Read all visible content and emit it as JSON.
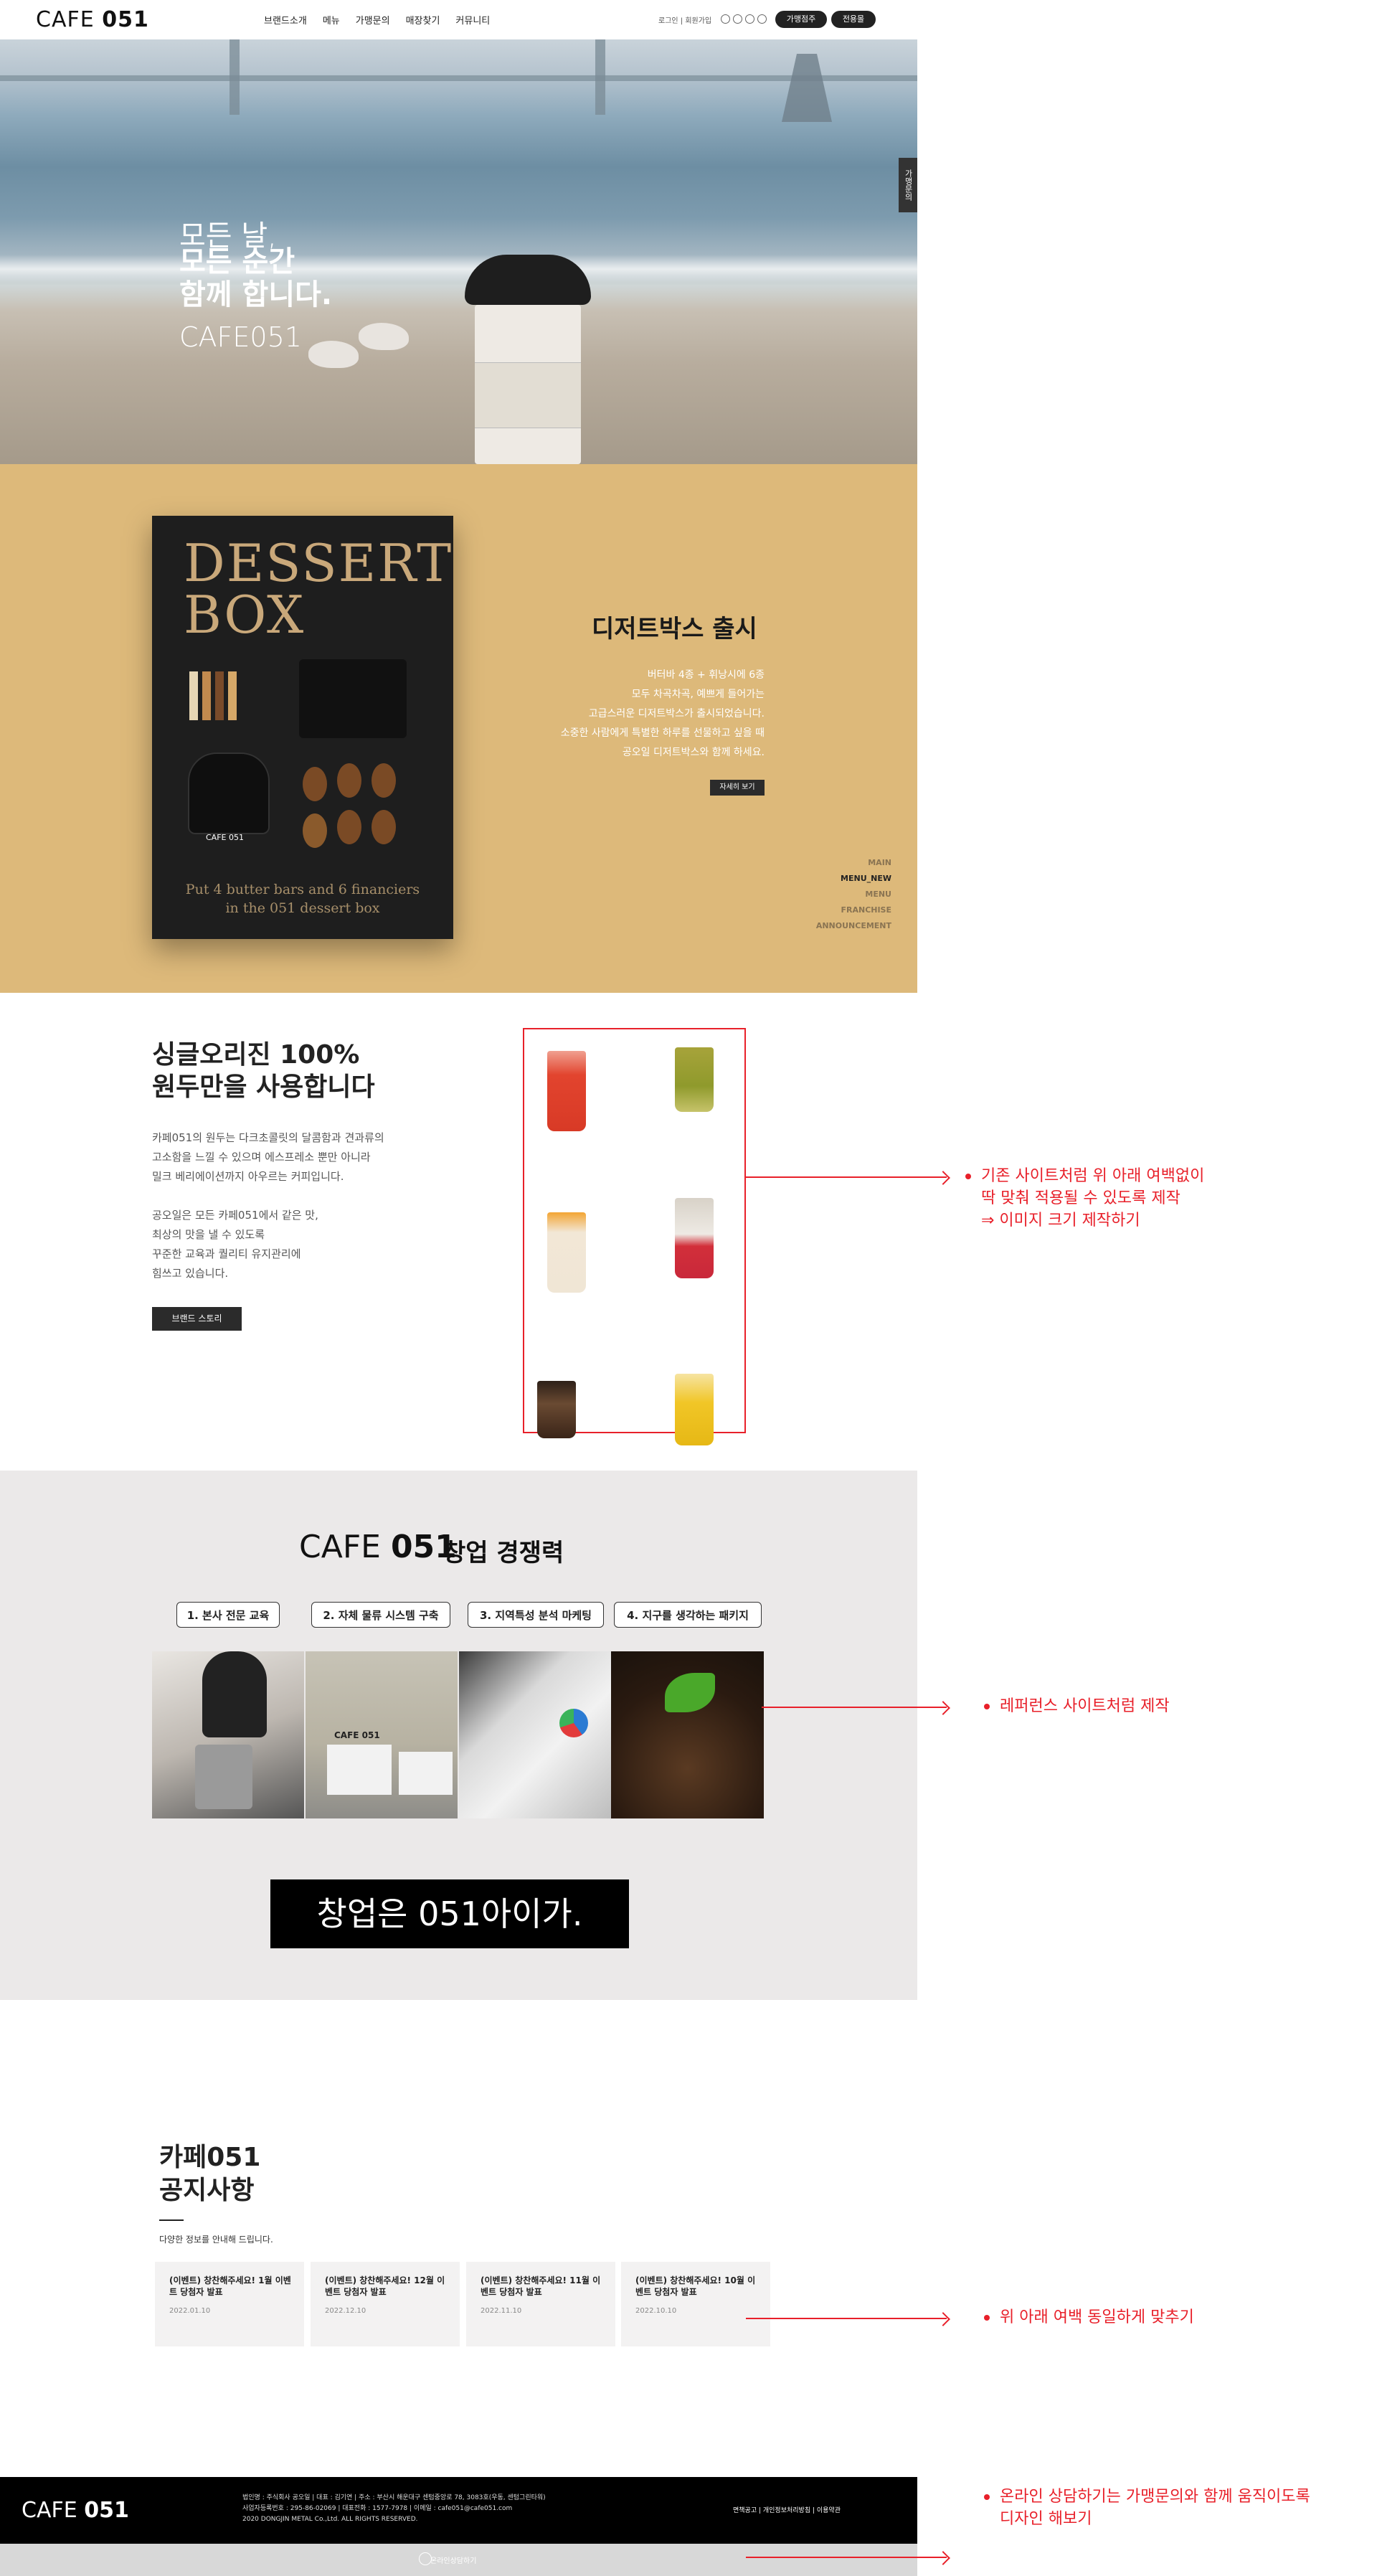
{
  "header": {
    "logo_light": "CAFE",
    "logo_bold": "051",
    "nav": [
      "브랜드소개",
      "메뉴",
      "가맹문의",
      "매장찾기",
      "커뮤니티"
    ],
    "util": "로그인 | 회원가입",
    "btn_franchise": "가맹점주",
    "btn_all": "전용몰"
  },
  "hero": {
    "line1": "모든 날,",
    "line2a": "모든 순간",
    "line2b": "함께 합니다.",
    "line3": "CAFE051",
    "side_tab": "가맹문의"
  },
  "dessert": {
    "box_title_1": "DESSERT",
    "box_title_2": "BOX",
    "box_brand": "CAFE 051",
    "box_sub_1": "Put 4 butter bars and 6 financiers",
    "box_sub_2": "in the 051 dessert box",
    "title": "디저트박스 출시",
    "desc": [
      "버터바 4종 + 휘낭시에 6종",
      "모두 차곡차곡, 예쁘게 들어가는",
      "고급스러운 디저트박스가 출시되었습니다.",
      "소중한 사람에게 특별한 하루를 선물하고 싶을 때",
      "공오일 디저트박스와 함께 하세요."
    ],
    "button": "자세히 보기",
    "side_nav": [
      "MAIN",
      "MENU_NEW",
      "MENU",
      "FRANCHISE",
      "ANNOUNCEMENT"
    ]
  },
  "coffee": {
    "title_1": "싱글오리진 100%",
    "title_2": "원두만을 사용합니다",
    "desc": [
      "카페051의 원두는 다크초콜릿의 달콤함과 견과류의",
      "고소함을 느낄 수 있으며 에스프레소 뿐만 아니라",
      "밀크 베리에이션까지 아우르는 커피입니다.",
      "",
      "공오일은 모든 카페051에서 같은 맛,",
      "최상의 맛을 낼 수 있도록",
      "꾸준한 교육과 퀄리티 유지관리에",
      "힘쓰고 있습니다."
    ],
    "button": "브랜드 스토리"
  },
  "annotations": {
    "a1": [
      "기존 사이트처럼 위 아래 여백없이",
      "딱 맞춰 적용될 수 있도록 제작",
      "⇒ 이미지 크기 제작하기"
    ],
    "a2": "레퍼런스 사이트처럼 제작",
    "a3": "위 아래 여백 동일하게 맞추기",
    "a4": [
      "온라인 상담하기는 가맹문의와 함께 움직이도록",
      "디자인 해보기"
    ]
  },
  "franchise": {
    "logo_light": "CAFE",
    "logo_bold": "051",
    "title": "창업 경쟁력",
    "tabs": [
      "1. 본사 전문 교육",
      "2. 자체 물류 시스템 구축",
      "3. 지역특성 분석 마케팅",
      "4. 지구를 생각하는 패키지"
    ],
    "truck_label": "CAFE 051",
    "banner": "창업은 051아이가."
  },
  "notice": {
    "title_1": "카페051",
    "title_2": "공지사항",
    "sub": "다양한 정보를 안내해 드립니다.",
    "cards": [
      {
        "title": "(이벤트) 창찬해주세요! 1월 이벤트 당첨자 발표",
        "date": "2022.01.10"
      },
      {
        "title": "(이벤트) 창찬해주세요! 12월 이벤트 당첨자 발표",
        "date": "2022.12.10"
      },
      {
        "title": "(이벤트) 창찬해주세요! 11월 이벤트 당첨자 발표",
        "date": "2022.11.10"
      },
      {
        "title": "(이벤트) 창찬해주세요! 10월 이벤트 당첨자 발표",
        "date": "2022.10.10"
      }
    ]
  },
  "footer": {
    "logo_light": "CAFE",
    "logo_bold": "051",
    "info": [
      "법인명 : 주식회사 공오일 | 대표 : 김기연 | 주소 : 부산시 해운대구 센텀중앙로 78, 3083호(우동, 센텀그린타워)",
      "사업자등록번호 : 295-86-02069 | 대표전화 : 1577-7978 | 이메일 : cafe051@cafe051.com",
      "2020 DONGJIN METAL Co.,Ltd. ALL RIGHTS RESERVED."
    ],
    "links": "면책공고 | 개인정보처리방침 | 이용약관",
    "online": "온라인상담하기"
  }
}
